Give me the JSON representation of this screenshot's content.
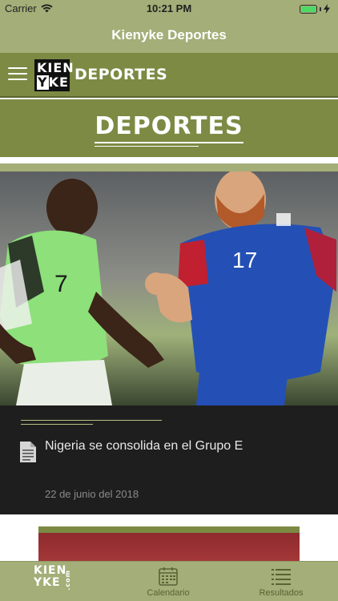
{
  "status_bar": {
    "carrier": "Carrier",
    "time": "10:21 PM",
    "battery_level": 1.0
  },
  "nav": {
    "title": "Kienyke Deportes"
  },
  "section_bar": {
    "logo_line1": "KIEN",
    "logo_y": "Y",
    "logo_rest": "KE",
    "label": "DEPORTES"
  },
  "header": {
    "title": "DEPORTES"
  },
  "article": {
    "image_alt": "Partido de fútbol Nigeria vs Islandia",
    "title": "Nigeria se consolida en el Grupo E",
    "date": "22 de junio del 2018"
  },
  "tabbar": {
    "items": [
      {
        "label": "",
        "icon": "kienyke-logo-icon",
        "logo_line1": "KIEN",
        "logo_line2": "YKE",
        "logo_suffix": ".com"
      },
      {
        "label": "Calendario",
        "icon": "calendar-icon"
      },
      {
        "label": "Resultados",
        "icon": "list-icon"
      }
    ]
  },
  "colors": {
    "primary": "#a3ae78",
    "section": "#7c8a44",
    "card_body": "#1f1e1e",
    "accent_line": "#b6bf84"
  }
}
